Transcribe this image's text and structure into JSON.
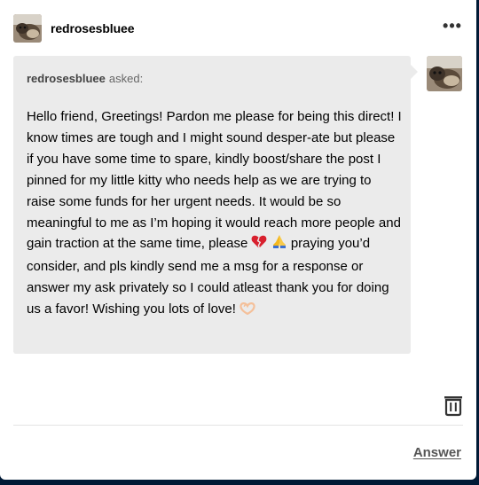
{
  "post": {
    "username": "redrosesbluee",
    "more_label": "•••"
  },
  "ask": {
    "asker": "redrosesbluee",
    "asked_label": "asked:",
    "text_part1": "Hello friend, Greetings! Pardon me please for being this direct! I know times are tough and I might sound desper-ate but please if you have some time to spare, kindly boost/share the post I pinned for my little kitty who needs help as we are trying to raise some funds for her urgent needs. It would be so meaningful to me as I’m hoping it would reach more people and gain traction at the same time, please ",
    "text_part2": " praying you’d consider, and pls kindly send me a msg for a response or answer my ask privately so I could atleast thank you for doing us a favor! Wishing you lots of love! ",
    "emojis": [
      "broken-heart-icon",
      "folded-hands-icon",
      "heart-hands-icon"
    ]
  },
  "actions": {
    "answer_label": "Answer",
    "delete_icon": "trash-icon"
  },
  "colors": {
    "page_background": "#001935",
    "bubble": "#ebebeb",
    "text": "#000000"
  }
}
